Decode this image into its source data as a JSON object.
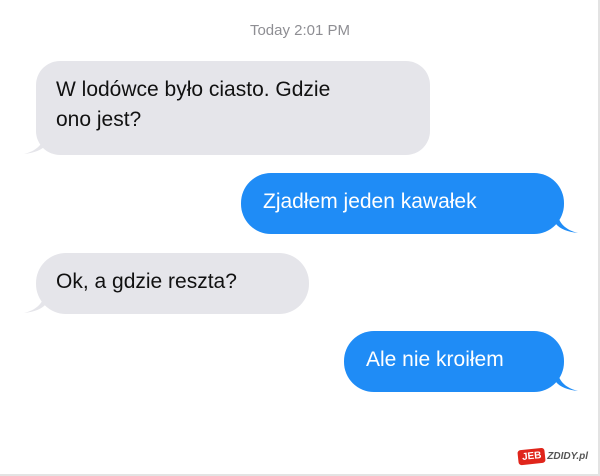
{
  "conversation": {
    "timestamp": "Today 2:01 PM",
    "messages": [
      {
        "side": "received",
        "lines": [
          "W lodówce było ciasto. Gdzie",
          "ono jest?"
        ]
      },
      {
        "side": "sent",
        "lines": [
          "Zjadłem jeden kawałek"
        ]
      },
      {
        "side": "received",
        "lines": [
          "Ok, a gdzie reszta?"
        ]
      },
      {
        "side": "sent",
        "lines": [
          "Ale nie kroiłem"
        ]
      }
    ]
  },
  "colors": {
    "received_bubble": "#e5e5ea",
    "sent_bubble": "#1f8cf6",
    "timestamp_text": "#8e8e93"
  },
  "watermark": {
    "badge": "JEB",
    "text": "ZDIDY.pl"
  }
}
